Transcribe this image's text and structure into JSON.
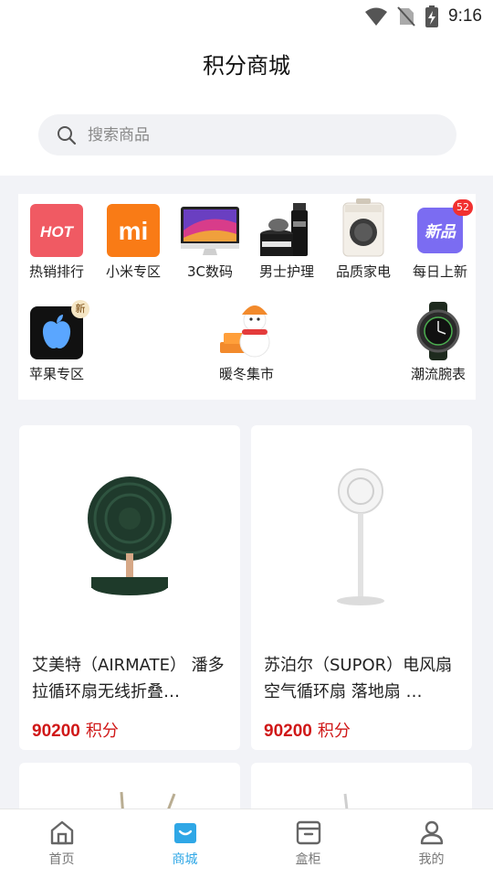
{
  "status_bar": {
    "time": "9:16"
  },
  "header": {
    "title": "积分商城"
  },
  "search": {
    "placeholder": "搜索商品"
  },
  "categories": [
    {
      "label": "热销排行",
      "icon": "hot-icon",
      "tile_text": "HOT"
    },
    {
      "label": "小米专区",
      "icon": "xiaomi-logo-icon",
      "tile_text": "mi"
    },
    {
      "label": "3C数码",
      "icon": "imac-icon"
    },
    {
      "label": "男士护理",
      "icon": "mens-care-products-icon"
    },
    {
      "label": "品质家电",
      "icon": "washing-machine-icon"
    },
    {
      "label": "每日上新",
      "icon": "new-products-icon",
      "tile_text": "新品",
      "badge": "52"
    },
    {
      "label": "苹果专区",
      "icon": "apple-logo-icon",
      "badge": "新"
    },
    {
      "label": "暖冬集市",
      "icon": "snowman-icon"
    },
    {
      "label": "潮流腕表",
      "icon": "wristwatch-icon"
    }
  ],
  "products": [
    {
      "name": "艾美特（AIRMATE） 潘多拉循环扇无线折叠…",
      "price": "90200",
      "unit": "积分"
    },
    {
      "name": "苏泊尔（SUPOR）电风扇 空气循环扇 落地扇 …",
      "price": "90200",
      "unit": "积分"
    }
  ],
  "tabbar": [
    {
      "label": "首页",
      "icon": "home-icon",
      "active": false
    },
    {
      "label": "商城",
      "icon": "shopping-bag-icon",
      "active": true
    },
    {
      "label": "盒柜",
      "icon": "box-icon",
      "active": false
    },
    {
      "label": "我的",
      "icon": "user-icon",
      "active": false
    }
  ],
  "colors": {
    "price": "#d01818",
    "tab_active": "#2fa7e6",
    "badge": "#f13030"
  }
}
